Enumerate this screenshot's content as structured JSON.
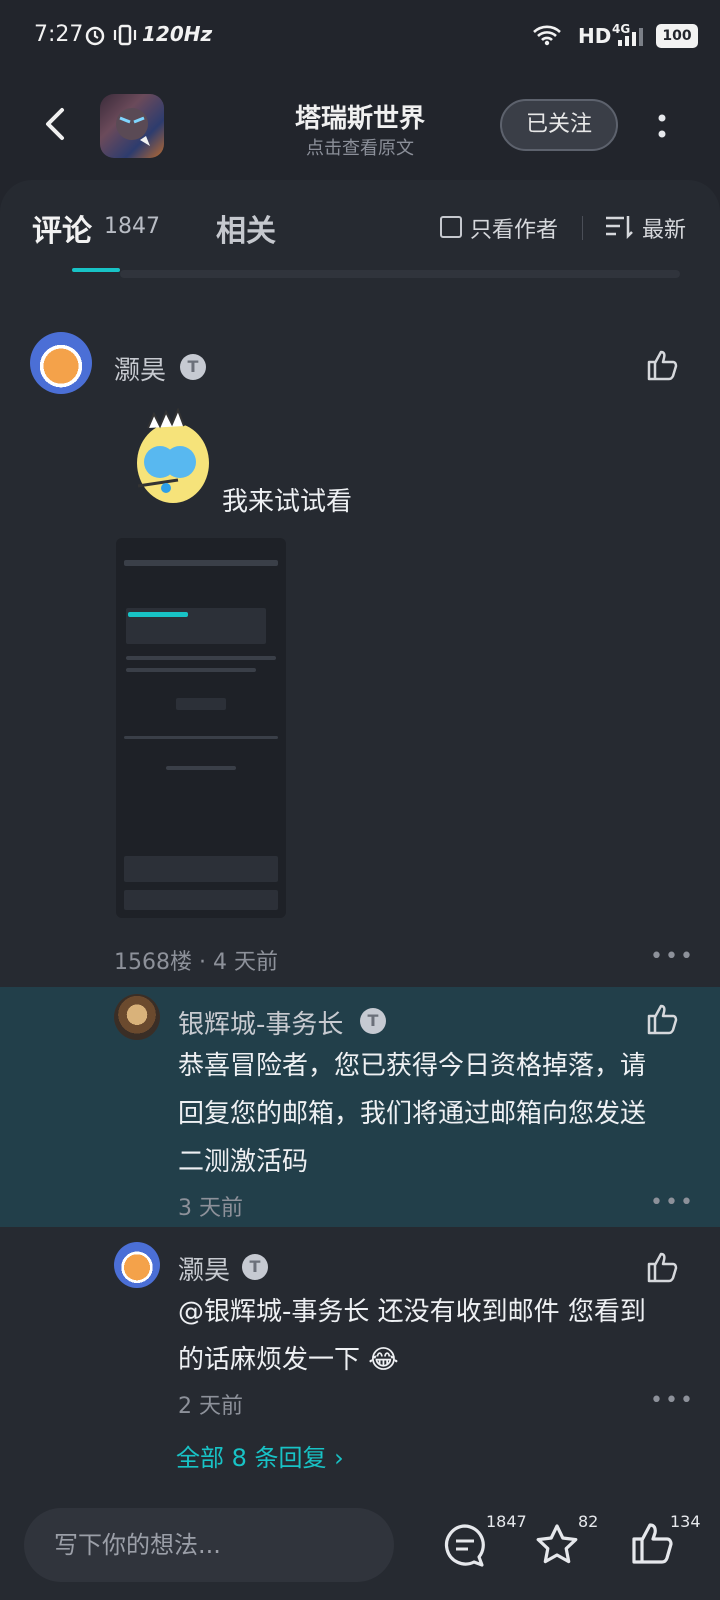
{
  "status_bar": {
    "time": "7:27",
    "refresh_rate": "120Hz",
    "network": "HD",
    "cell": "4G",
    "battery": "100"
  },
  "header": {
    "title": "塔瑞斯世界",
    "subtitle": "点击查看原文",
    "follow_label": "已关注"
  },
  "tabs": {
    "comments_label": "评论",
    "comments_count": "1847",
    "related_label": "相关",
    "only_author_label": "只看作者",
    "sort_label": "最新"
  },
  "main_comment": {
    "user": "灏昊",
    "badge": "T",
    "text": "我来试试看",
    "floor_time": "1568楼 · 4 天前"
  },
  "replies": [
    {
      "user": "银辉城-事务长",
      "badge": "T",
      "text_lines": [
        "恭喜冒险者，您已获得今日资格掉落，请",
        "回复您的邮箱，我们将通过邮箱向您发送",
        "二测激活码"
      ],
      "time": "3 天前"
    },
    {
      "user": "灏昊",
      "badge": "T",
      "text_lines": [
        "@银辉城-事务长  还没有收到邮件 您看到",
        "的话麻烦发一下 😂"
      ],
      "time": "2 天前"
    }
  ],
  "more_replies": "全部 8 条回复 ›",
  "bottom_bar": {
    "input_placeholder": "写下你的想法...",
    "comment_count": "1847",
    "star_count": "82",
    "like_count": "134"
  },
  "colors": {
    "accent": "#18c3c6",
    "background": "#22252c",
    "highlight_row": "#223f4a"
  }
}
